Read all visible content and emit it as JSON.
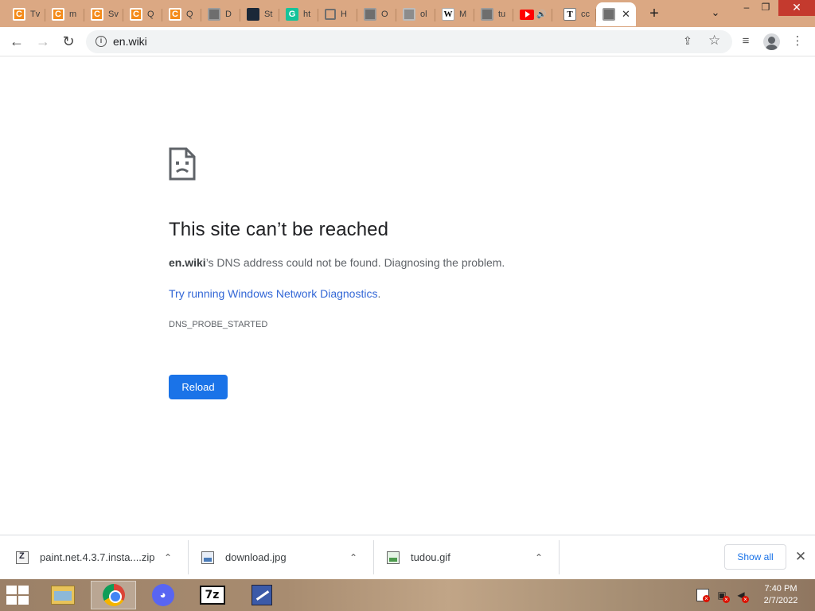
{
  "tabs": [
    {
      "title": "Tv",
      "favicon": "crunchyroll-icon"
    },
    {
      "title": "m",
      "favicon": "crunchyroll-icon"
    },
    {
      "title": "Sv",
      "favicon": "crunchyroll-icon"
    },
    {
      "title": "Q",
      "favicon": "crunchyroll-icon"
    },
    {
      "title": "Q",
      "favicon": "crunchyroll-icon"
    },
    {
      "title": "D",
      "favicon": "globe-icon"
    },
    {
      "title": "St",
      "favicon": "steam-icon"
    },
    {
      "title": "ht",
      "favicon": "grammarly-icon"
    },
    {
      "title": "H",
      "favicon": "history-icon"
    },
    {
      "title": "O",
      "favicon": "globe-icon"
    },
    {
      "title": "ol",
      "favicon": "globe-icon"
    },
    {
      "title": "M",
      "favicon": "wikipedia-icon"
    },
    {
      "title": "tu",
      "favicon": "globe-icon"
    },
    {
      "title": "",
      "favicon": "youtube-icon"
    },
    {
      "title": "cc",
      "favicon": "t-icon"
    },
    {
      "title": "",
      "favicon": "globe-icon",
      "active": true
    }
  ],
  "crunchy_letter": "C",
  "grammarly_letter": "G",
  "wiki_letter": "W",
  "t_letter": "T",
  "tab_close": "✕",
  "new_tab": "+",
  "tab_search": "⌄",
  "window_controls": {
    "minimize": "–",
    "restore": "❐",
    "close": "✕"
  },
  "toolbar": {
    "back": "←",
    "forward": "→",
    "reload": "↻",
    "url": "en.wiki",
    "info": "i",
    "share": "⇪",
    "bookmark": "☆",
    "reading_list": "≡",
    "menu": "⋮"
  },
  "error": {
    "title": "This site can’t be reached",
    "host": "en.wiki",
    "description": "’s DNS address could not be found. Diagnosing the problem.",
    "link_text": "Try running Windows Network Diagnostics",
    "link_suffix": ".",
    "code": "DNS_PROBE_STARTED",
    "reload_label": "Reload"
  },
  "downloads": [
    {
      "name": "paint.net.4.3.7.insta....zip",
      "type": "zip"
    },
    {
      "name": "download.jpg",
      "type": "img"
    },
    {
      "name": "tudou.gif",
      "type": "gif"
    }
  ],
  "download_caret": "⌃",
  "show_all": "Show all",
  "shelf_close": "✕",
  "taskbar": {
    "apps": [
      "file-explorer",
      "chrome",
      "discord",
      "7-zip",
      "paint.net"
    ],
    "discord_glyph": "◕",
    "sevenzip_label": "7z",
    "clock_time": "7:40 PM",
    "clock_date": "2/7/2022"
  },
  "colors": {
    "tabstrip": "#dba883",
    "link": "#3367d6",
    "reload_button": "#1a73e8"
  }
}
